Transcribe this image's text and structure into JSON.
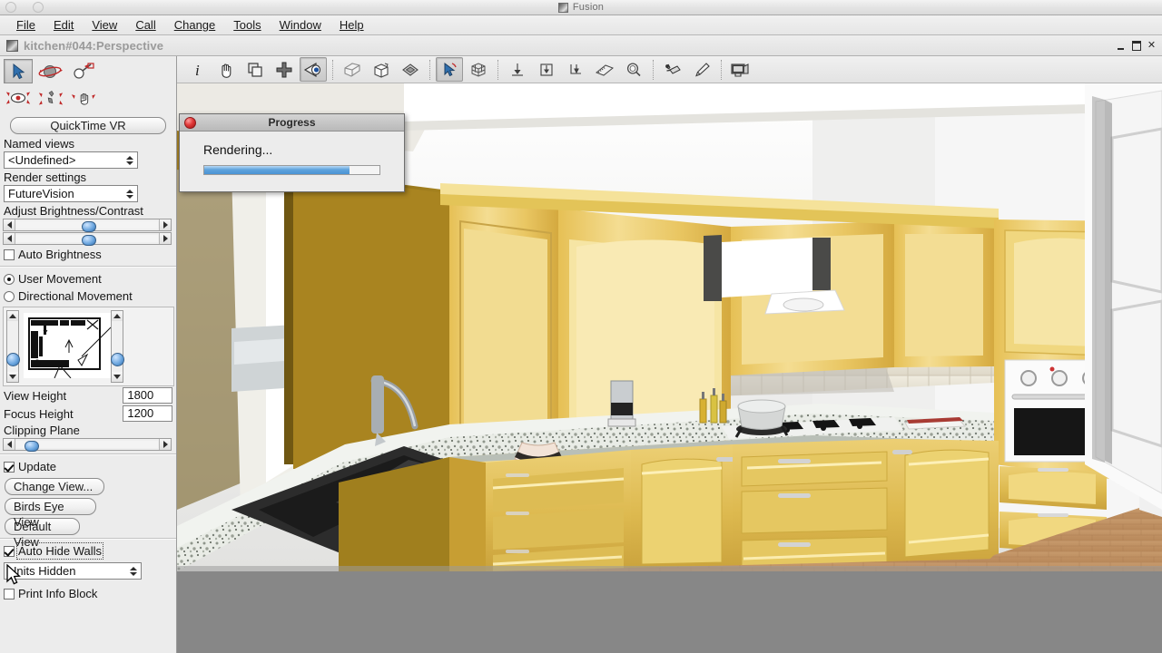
{
  "window": {
    "app_title": "Fusion",
    "document_title": "kitchen#044:Perspective",
    "minimize_label": "_",
    "restore_label": "❐",
    "close_label": "✕"
  },
  "menubar": {
    "items": [
      {
        "label": "File"
      },
      {
        "label": "Edit"
      },
      {
        "label": "View"
      },
      {
        "label": "Call"
      },
      {
        "label": "Change"
      },
      {
        "label": "Tools"
      },
      {
        "label": "Window"
      },
      {
        "label": "Help"
      }
    ]
  },
  "toolbar": {
    "items": [
      {
        "name": "info-icon",
        "title": "Info"
      },
      {
        "name": "pan-hand-icon",
        "title": "Pan"
      },
      {
        "name": "copy-layers-icon",
        "title": "Copy"
      },
      {
        "name": "add-plus-icon",
        "title": "Add"
      },
      {
        "name": "eye-view-icon",
        "title": "View",
        "active": true
      },
      {
        "name": "elevation-cube-icon",
        "title": "Elevation"
      },
      {
        "name": "perspective-box-icon",
        "title": "Perspective"
      },
      {
        "name": "plan-diamond-icon",
        "title": "Plan"
      },
      {
        "name": "select-arrow-icon",
        "title": "Select",
        "active": true
      },
      {
        "name": "render-cube-icon",
        "title": "Render"
      },
      {
        "name": "dimension-down-icon",
        "title": "Dimension"
      },
      {
        "name": "dimension-box-icon",
        "title": "Dimension Box"
      },
      {
        "name": "dimension-angle-icon",
        "title": "Dimension Angle"
      },
      {
        "name": "tape-measure-icon",
        "title": "Measure"
      },
      {
        "name": "zoom-magnifier-icon",
        "title": "Zoom"
      },
      {
        "name": "lighting-icon",
        "title": "Lighting"
      },
      {
        "name": "paint-brush-icon",
        "title": "Paint"
      },
      {
        "name": "monitor-presentation-icon",
        "title": "Presentation"
      }
    ]
  },
  "sidebar": {
    "nav_tools_row1": [
      {
        "name": "arrow-select-icon",
        "active": true
      },
      {
        "name": "orbit-planet-icon",
        "active": false
      },
      {
        "name": "spotlight-search-icon",
        "active": false
      }
    ],
    "nav_tools_row2": [
      {
        "name": "eye-look-icon",
        "active": false
      },
      {
        "name": "walk-move-icon",
        "active": false
      },
      {
        "name": "hand-drag-icon",
        "active": false
      }
    ],
    "quicktime_vr_button": "QuickTime VR",
    "named_views_label": "Named views",
    "named_views_value": "<Undefined>",
    "render_settings_label": "Render settings",
    "render_settings_value": "FutureVision",
    "adjust_label": "Adjust Brightness/Contrast",
    "brightness_slider_pct": 46,
    "contrast_slider_pct": 46,
    "auto_brightness_label": "Auto Brightness",
    "auto_brightness_checked": false,
    "user_movement_label": "User Movement",
    "user_movement_selected": true,
    "directional_movement_label": "Directional Movement",
    "directional_movement_selected": false,
    "view_height_label": "View Height",
    "view_height_value": "1800",
    "focus_height_label": "Focus Height",
    "focus_height_value": "1200",
    "clipping_plane_label": "Clipping Plane",
    "clipping_plane_pct": 6,
    "update_label": "Update",
    "update_checked": true,
    "change_view_button": "Change View...",
    "birds_eye_button": "Birds Eye View",
    "default_view_button": "Default View",
    "auto_hide_walls_label": "Auto Hide Walls",
    "auto_hide_walls_checked": true,
    "units_hidden_value": "Units Hidden",
    "print_info_block_label": "Print Info Block",
    "print_info_block_checked": false
  },
  "progress_dialog": {
    "title": "Progress",
    "message": "Rendering...",
    "progress_pct": 83,
    "close_icon": "close-red-icon"
  },
  "viewport": {
    "scene_description": "3D rendered kitchen perspective with wood cabinets, granite worktop, hob, oven and tiled splashback"
  },
  "colors": {
    "accent_blue": "#5fa3dd",
    "panel_bg": "#ececec",
    "menu_bg": "#f1f1f1",
    "bottom_gray": "#878787",
    "cabinet_wood": "#e8c76a",
    "wall_white": "#f2f0eb"
  }
}
